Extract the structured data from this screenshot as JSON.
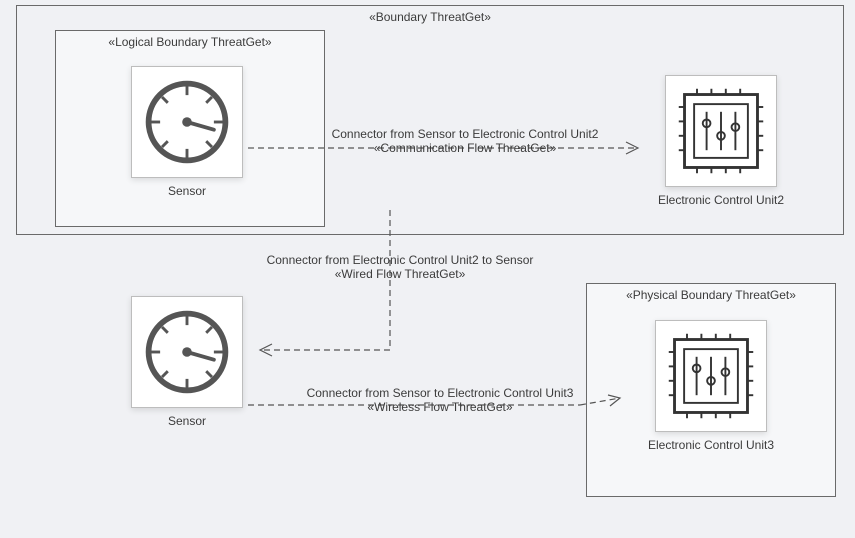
{
  "outerBoundary": {
    "title": "«Boundary ThreatGet»"
  },
  "logicalBoundary": {
    "title": "«Logical Boundary ThreatGet»"
  },
  "physicalBoundary": {
    "title": "«Physical Boundary ThreatGet»"
  },
  "nodes": {
    "sensor1": {
      "label": "Sensor"
    },
    "ecu2": {
      "label": "Electronic Control Unit2"
    },
    "sensor2": {
      "label": "Sensor"
    },
    "ecu3": {
      "label": "Electronic Control Unit3"
    }
  },
  "connectors": {
    "c1": {
      "line1": "Connector from Sensor to Electronic Control Unit2",
      "line2": "«Communication Flow ThreatGet»"
    },
    "c2": {
      "line1": "Connector from Electronic Control Unit2 to Sensor",
      "line2": "«Wired Flow ThreatGet»"
    },
    "c3": {
      "line1": "Connector from Sensor to Electronic Control Unit3",
      "line2": "«Wireless Flow ThreatGet»"
    }
  },
  "colors": {
    "bg": "#f0f1f4",
    "border": "#6a6a6a",
    "text": "#3b3b3b"
  }
}
